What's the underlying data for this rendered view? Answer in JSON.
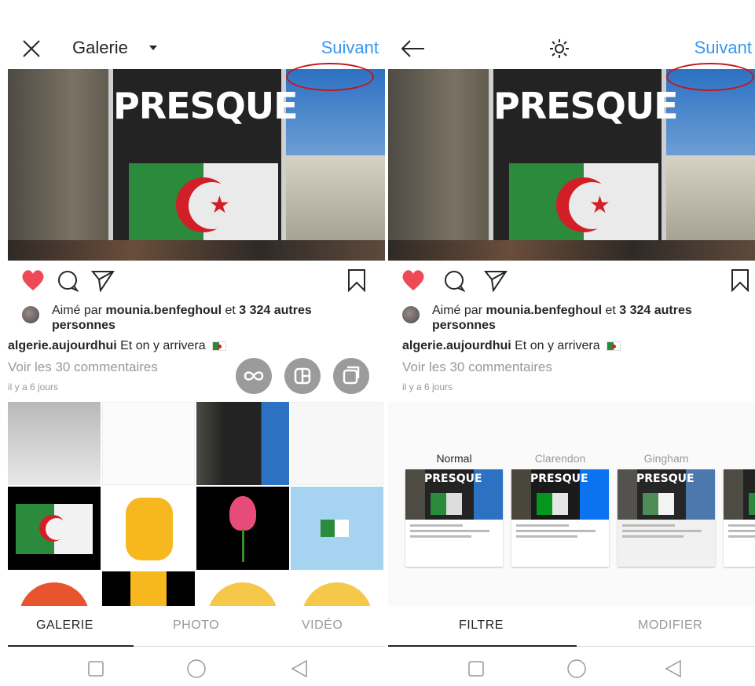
{
  "colors": {
    "accent": "#3897f0",
    "heart": "#ed4956",
    "arrow": "#e8161c"
  },
  "left": {
    "header": {
      "title": "Galerie",
      "next": "Suivant"
    },
    "post": {
      "liked_prefix": "Aimé par ",
      "liked_user": "mounia.benfeghoul",
      "liked_mid": " et ",
      "liked_count": "3 324 autres",
      "liked_suffix": "personnes",
      "caption_user": "algerie.aujourdhui",
      "caption_text": " Et on y arrivera ",
      "comments": "Voir les 30 commentaires",
      "time": "il y a 6 jours",
      "photo_text": "PRESQUE"
    },
    "tabs": {
      "gallery": "GALERIE",
      "photo": "PHOTO",
      "video": "VIDÉO"
    }
  },
  "right": {
    "header": {
      "next": "Suivant"
    },
    "post": {
      "liked_prefix": "Aimé par ",
      "liked_user": "mounia.benfeghoul",
      "liked_mid": " et ",
      "liked_count": "3 324 autres",
      "liked_suffix": "personnes",
      "caption_user": "algerie.aujourdhui",
      "caption_text": " Et on y arrivera ",
      "comments": "Voir les 30 commentaires",
      "time": "il y a 6 jours",
      "photo_text": "PRESQUE"
    },
    "filters": [
      {
        "name": "Normal",
        "thumb_text": "PRESQUE"
      },
      {
        "name": "Clarendon",
        "thumb_text": "PRESQUE"
      },
      {
        "name": "Gingham",
        "thumb_text": "PRESQUE"
      }
    ],
    "tabs": {
      "filter": "FILTRE",
      "edit": "MODIFIER"
    }
  }
}
